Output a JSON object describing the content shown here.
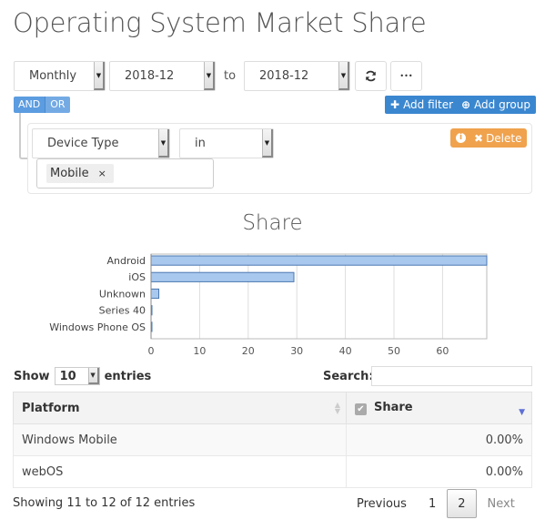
{
  "page": {
    "title": "Operating System Market Share"
  },
  "toolbar": {
    "interval": "Monthly",
    "from": "2018-12",
    "to_label": "to",
    "to": "2018-12",
    "refresh_icon": "refresh-icon",
    "more_label": "•••"
  },
  "builder": {
    "and_label": "AND",
    "or_label": "OR",
    "add_filter_label": "Add filter",
    "add_group_label": "Add group",
    "rule": {
      "field": "Device Type",
      "operator": "in",
      "values": [
        "Mobile"
      ],
      "delete_label": "Delete"
    }
  },
  "chart_data": {
    "type": "bar",
    "orientation": "horizontal",
    "title": "Share",
    "categories": [
      "Android",
      "iOS",
      "Unknown",
      "Series 40",
      "Windows Phone OS"
    ],
    "values": [
      69.1,
      29.4,
      1.6,
      0.1,
      0.1
    ],
    "xlim": [
      0,
      69.1
    ],
    "xticks": [
      0,
      10,
      20,
      30,
      40,
      50,
      60
    ],
    "grid": true,
    "bar_color": "#a9c8ee",
    "bar_border": "#4a78b0"
  },
  "table": {
    "show_label": "Show",
    "length": "10",
    "entries_label": "entries",
    "search_label": "Search:",
    "search_value": "",
    "columns": [
      "Platform",
      "Share"
    ],
    "rows": [
      {
        "platform": "Windows Mobile",
        "share": "0.00%"
      },
      {
        "platform": "webOS",
        "share": "0.00%"
      }
    ],
    "info": "Showing 11 to 12 of 12 entries",
    "pagination": {
      "previous": "Previous",
      "pages": [
        "1",
        "2"
      ],
      "current": "2",
      "next": "Next"
    }
  }
}
